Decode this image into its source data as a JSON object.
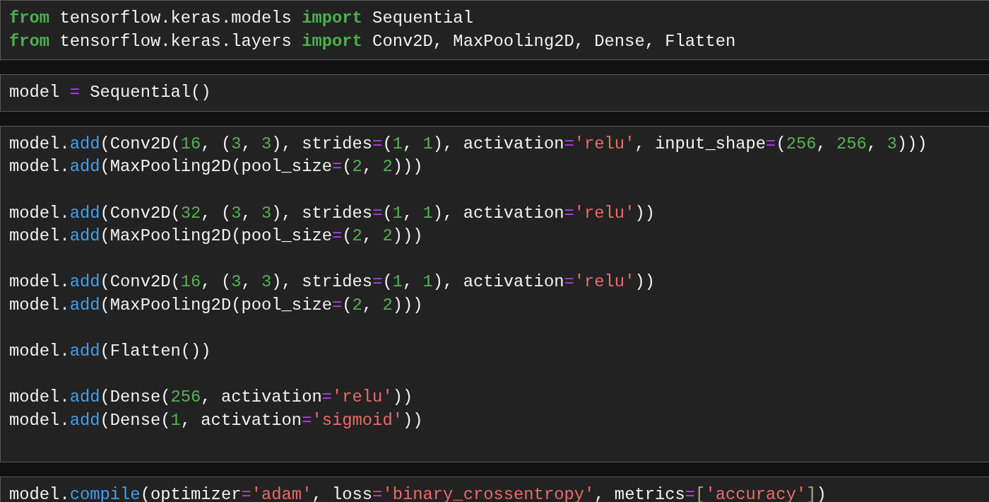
{
  "cells": [
    {
      "lines": [
        {
          "tokens": [
            {
              "text": "from",
              "kind": "keyword"
            },
            {
              "text": " tensorflow.keras.models ",
              "kind": "plain"
            },
            {
              "text": "import",
              "kind": "keyword"
            },
            {
              "text": " Sequential",
              "kind": "plain"
            }
          ]
        },
        {
          "tokens": [
            {
              "text": "from",
              "kind": "keyword"
            },
            {
              "text": " tensorflow.keras.layers ",
              "kind": "plain"
            },
            {
              "text": "import",
              "kind": "keyword"
            },
            {
              "text": " Conv2D, MaxPooling2D, Dense, Flatten",
              "kind": "plain"
            }
          ]
        }
      ]
    },
    {
      "lines": [
        {
          "tokens": [
            {
              "text": "model ",
              "kind": "plain"
            },
            {
              "text": "=",
              "kind": "operator"
            },
            {
              "text": " Sequential()",
              "kind": "plain"
            }
          ]
        }
      ]
    },
    {
      "lines": [
        {
          "tokens": [
            {
              "text": "model.",
              "kind": "plain"
            },
            {
              "text": "add",
              "kind": "function"
            },
            {
              "text": "(Conv2D(",
              "kind": "plain"
            },
            {
              "text": "16",
              "kind": "number"
            },
            {
              "text": ", (",
              "kind": "plain"
            },
            {
              "text": "3",
              "kind": "number"
            },
            {
              "text": ", ",
              "kind": "plain"
            },
            {
              "text": "3",
              "kind": "number"
            },
            {
              "text": "), strides",
              "kind": "plain"
            },
            {
              "text": "=",
              "kind": "operator"
            },
            {
              "text": "(",
              "kind": "plain"
            },
            {
              "text": "1",
              "kind": "number"
            },
            {
              "text": ", ",
              "kind": "plain"
            },
            {
              "text": "1",
              "kind": "number"
            },
            {
              "text": "), activation",
              "kind": "plain"
            },
            {
              "text": "=",
              "kind": "operator"
            },
            {
              "text": "'relu'",
              "kind": "string"
            },
            {
              "text": ", input_shape",
              "kind": "plain"
            },
            {
              "text": "=",
              "kind": "operator"
            },
            {
              "text": "(",
              "kind": "plain"
            },
            {
              "text": "256",
              "kind": "number"
            },
            {
              "text": ", ",
              "kind": "plain"
            },
            {
              "text": "256",
              "kind": "number"
            },
            {
              "text": ", ",
              "kind": "plain"
            },
            {
              "text": "3",
              "kind": "number"
            },
            {
              "text": ")))",
              "kind": "plain"
            }
          ]
        },
        {
          "tokens": [
            {
              "text": "model.",
              "kind": "plain"
            },
            {
              "text": "add",
              "kind": "function"
            },
            {
              "text": "(MaxPooling2D(pool_size",
              "kind": "plain"
            },
            {
              "text": "=",
              "kind": "operator"
            },
            {
              "text": "(",
              "kind": "plain"
            },
            {
              "text": "2",
              "kind": "number"
            },
            {
              "text": ", ",
              "kind": "plain"
            },
            {
              "text": "2",
              "kind": "number"
            },
            {
              "text": ")))",
              "kind": "plain"
            }
          ]
        },
        {
          "kind": "blank"
        },
        {
          "tokens": [
            {
              "text": "model.",
              "kind": "plain"
            },
            {
              "text": "add",
              "kind": "function"
            },
            {
              "text": "(Conv2D(",
              "kind": "plain"
            },
            {
              "text": "32",
              "kind": "number"
            },
            {
              "text": ", (",
              "kind": "plain"
            },
            {
              "text": "3",
              "kind": "number"
            },
            {
              "text": ", ",
              "kind": "plain"
            },
            {
              "text": "3",
              "kind": "number"
            },
            {
              "text": "), strides",
              "kind": "plain"
            },
            {
              "text": "=",
              "kind": "operator"
            },
            {
              "text": "(",
              "kind": "plain"
            },
            {
              "text": "1",
              "kind": "number"
            },
            {
              "text": ", ",
              "kind": "plain"
            },
            {
              "text": "1",
              "kind": "number"
            },
            {
              "text": "), activation",
              "kind": "plain"
            },
            {
              "text": "=",
              "kind": "operator"
            },
            {
              "text": "'relu'",
              "kind": "string"
            },
            {
              "text": "))",
              "kind": "plain"
            }
          ]
        },
        {
          "tokens": [
            {
              "text": "model.",
              "kind": "plain"
            },
            {
              "text": "add",
              "kind": "function"
            },
            {
              "text": "(MaxPooling2D(pool_size",
              "kind": "plain"
            },
            {
              "text": "=",
              "kind": "operator"
            },
            {
              "text": "(",
              "kind": "plain"
            },
            {
              "text": "2",
              "kind": "number"
            },
            {
              "text": ", ",
              "kind": "plain"
            },
            {
              "text": "2",
              "kind": "number"
            },
            {
              "text": ")))",
              "kind": "plain"
            }
          ]
        },
        {
          "kind": "blank"
        },
        {
          "tokens": [
            {
              "text": "model.",
              "kind": "plain"
            },
            {
              "text": "add",
              "kind": "function"
            },
            {
              "text": "(Conv2D(",
              "kind": "plain"
            },
            {
              "text": "16",
              "kind": "number"
            },
            {
              "text": ", (",
              "kind": "plain"
            },
            {
              "text": "3",
              "kind": "number"
            },
            {
              "text": ", ",
              "kind": "plain"
            },
            {
              "text": "3",
              "kind": "number"
            },
            {
              "text": "), strides",
              "kind": "plain"
            },
            {
              "text": "=",
              "kind": "operator"
            },
            {
              "text": "(",
              "kind": "plain"
            },
            {
              "text": "1",
              "kind": "number"
            },
            {
              "text": ", ",
              "kind": "plain"
            },
            {
              "text": "1",
              "kind": "number"
            },
            {
              "text": "), activation",
              "kind": "plain"
            },
            {
              "text": "=",
              "kind": "operator"
            },
            {
              "text": "'relu'",
              "kind": "string"
            },
            {
              "text": "))",
              "kind": "plain"
            }
          ]
        },
        {
          "tokens": [
            {
              "text": "model.",
              "kind": "plain"
            },
            {
              "text": "add",
              "kind": "function"
            },
            {
              "text": "(MaxPooling2D(pool_size",
              "kind": "plain"
            },
            {
              "text": "=",
              "kind": "operator"
            },
            {
              "text": "(",
              "kind": "plain"
            },
            {
              "text": "2",
              "kind": "number"
            },
            {
              "text": ", ",
              "kind": "plain"
            },
            {
              "text": "2",
              "kind": "number"
            },
            {
              "text": ")))",
              "kind": "plain"
            }
          ]
        },
        {
          "kind": "blank"
        },
        {
          "tokens": [
            {
              "text": "model.",
              "kind": "plain"
            },
            {
              "text": "add",
              "kind": "function"
            },
            {
              "text": "(Flatten())",
              "kind": "plain"
            }
          ]
        },
        {
          "kind": "blank"
        },
        {
          "tokens": [
            {
              "text": "model.",
              "kind": "plain"
            },
            {
              "text": "add",
              "kind": "function"
            },
            {
              "text": "(Dense(",
              "kind": "plain"
            },
            {
              "text": "256",
              "kind": "number"
            },
            {
              "text": ", activation",
              "kind": "plain"
            },
            {
              "text": "=",
              "kind": "operator"
            },
            {
              "text": "'relu'",
              "kind": "string"
            },
            {
              "text": "))",
              "kind": "plain"
            }
          ]
        },
        {
          "tokens": [
            {
              "text": "model.",
              "kind": "plain"
            },
            {
              "text": "add",
              "kind": "function"
            },
            {
              "text": "(Dense(",
              "kind": "plain"
            },
            {
              "text": "1",
              "kind": "number"
            },
            {
              "text": ", activation",
              "kind": "plain"
            },
            {
              "text": "=",
              "kind": "operator"
            },
            {
              "text": "'sigmoid'",
              "kind": "string"
            },
            {
              "text": "))",
              "kind": "plain"
            }
          ]
        },
        {
          "kind": "blank"
        }
      ]
    },
    {
      "lines": [
        {
          "tokens": [
            {
              "text": "model.",
              "kind": "plain"
            },
            {
              "text": "compile",
              "kind": "function"
            },
            {
              "text": "(optimizer",
              "kind": "plain"
            },
            {
              "text": "=",
              "kind": "operator"
            },
            {
              "text": "'adam'",
              "kind": "string"
            },
            {
              "text": ", loss",
              "kind": "plain"
            },
            {
              "text": "=",
              "kind": "operator"
            },
            {
              "text": "'binary_crossentropy'",
              "kind": "string"
            },
            {
              "text": ", metrics",
              "kind": "plain"
            },
            {
              "text": "=",
              "kind": "operator"
            },
            {
              "text": "[",
              "kind": "bracket"
            },
            {
              "text": "'accuracy'",
              "kind": "string"
            },
            {
              "text": "]",
              "kind": "bracket"
            },
            {
              "text": ")",
              "kind": "plain"
            }
          ]
        }
      ]
    }
  ]
}
